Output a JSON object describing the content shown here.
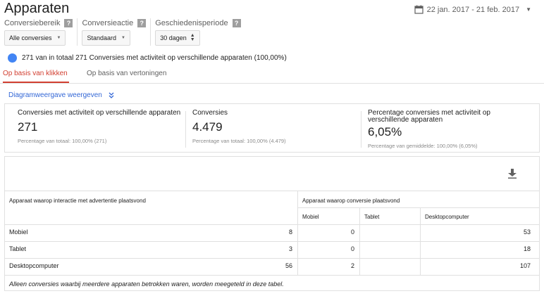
{
  "header": {
    "title": "Apparaten",
    "date_range": "22 jan. 2017 - 21 feb. 2017"
  },
  "filters": [
    {
      "label": "Conversiebereik",
      "help": "?",
      "value": "Alle conversies"
    },
    {
      "label": "Conversieactie",
      "help": "?",
      "value": "Standaard"
    },
    {
      "label": "Geschiedenisperiode",
      "help": "?",
      "value": "30 dagen"
    }
  ],
  "summary": {
    "text": "271 van in totaal 271 Conversies met activiteit op verschillende apparaten (100,00%)",
    "dot_color": "#4285f4"
  },
  "tabs": [
    {
      "label": "Op basis van klikken",
      "active": true
    },
    {
      "label": "Op basis van vertoningen",
      "active": false
    }
  ],
  "diagram_link": "Diagramweergave weergeven",
  "metrics": [
    {
      "label": "Conversies met activiteit op verschillende apparaten",
      "value": "271",
      "sub": "Percentage van totaal: 100,00% (271)"
    },
    {
      "label": "Conversies",
      "value": "4.479",
      "sub": "Percentage van totaal: 100,00% (4.479)"
    },
    {
      "label": "Percentage conversies met activiteit op verschillende apparaten",
      "value": "6,05%",
      "sub": "Percentage van gemiddelde: 100,00% (6,05%)"
    }
  ],
  "table": {
    "row_header": "Apparaat waarop interactie met advertentie plaatsvond",
    "group_header": "Apparaat waarop conversie plaatsvond",
    "columns": [
      "Mobiel",
      "Tablet",
      "Desktopcomputer"
    ],
    "rows": [
      {
        "label": "Mobiel",
        "values": [
          "8",
          "0",
          "53"
        ]
      },
      {
        "label": "Tablet",
        "values": [
          "3",
          "0",
          "18"
        ]
      },
      {
        "label": "Desktopcomputer",
        "values": [
          "56",
          "2",
          "107"
        ]
      }
    ],
    "footnote": "Alleen conversies waarbij meerdere apparaten betrokken waren, worden meegeteld in deze tabel."
  }
}
